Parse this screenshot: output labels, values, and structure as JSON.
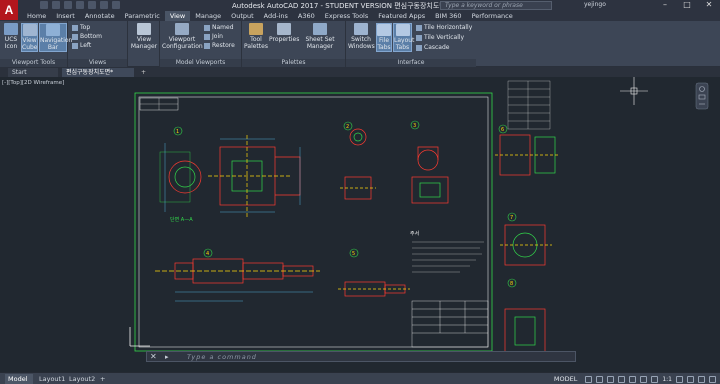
{
  "titlebar": {
    "app_logo": "A",
    "title": "Autodesk AutoCAD 2017 - STUDENT VERSION   편심구동장치도면.dwg",
    "search_placeholder": "Type a keyword or phrase",
    "user": "yejingo",
    "controls": [
      "–",
      "□",
      "✕"
    ]
  },
  "menu": {
    "tabs": [
      "Home",
      "Insert",
      "Annotate",
      "Parametric",
      "View",
      "Manage",
      "Output",
      "Add-ins",
      "A360",
      "Express Tools",
      "Featured Apps",
      "BIM 360",
      "Performance"
    ],
    "active": "View"
  },
  "ribbon": {
    "viewport_tools": {
      "title": "Viewport Tools",
      "buttons": [
        "UCS Icon",
        "View Cube",
        "Navigation Bar"
      ]
    },
    "views": {
      "title": "Views",
      "items": [
        "Top",
        "Bottom",
        "Left"
      ]
    },
    "view_manager": "View Manager",
    "model_viewports": {
      "title": "Model Viewports",
      "config": "Viewport Configuration",
      "items": [
        "Named",
        "Join",
        "Restore"
      ]
    },
    "palettes": {
      "title": "Palettes",
      "buttons": [
        "Tool Palettes",
        "Properties",
        "Sheet Set Manager"
      ]
    },
    "interface": {
      "title": "Interface",
      "buttons": [
        "Switch Windows",
        "File Tabs",
        "Layout Tabs"
      ],
      "items": [
        "Tile Horizontally",
        "Tile Vertically",
        "Cascade"
      ]
    }
  },
  "filetabs": {
    "start": "Start",
    "document": "편심구동장치도면*",
    "add": "+"
  },
  "viewport": {
    "label": "[-][Top][2D Wireframe]",
    "section_label": "단면 A—A",
    "notes_title": "주서",
    "part_numbers": [
      "1",
      "2",
      "3",
      "4",
      "5",
      "6",
      "7",
      "8"
    ]
  },
  "command": {
    "close": "✕",
    "prompt_arrow": "▸",
    "placeholder": "Type a command"
  },
  "status": {
    "layout_tabs": [
      "Model",
      "Layout1",
      "Layout2"
    ],
    "add": "+",
    "mode": "MODEL",
    "scale": "1:1"
  },
  "colors": {
    "background": "#212830",
    "drawing_lines": "#ff3b30",
    "green": "#32d74b",
    "yellow": "#ffd60a",
    "cyan": "#5ac8fa",
    "white": "#f2f2f2"
  }
}
